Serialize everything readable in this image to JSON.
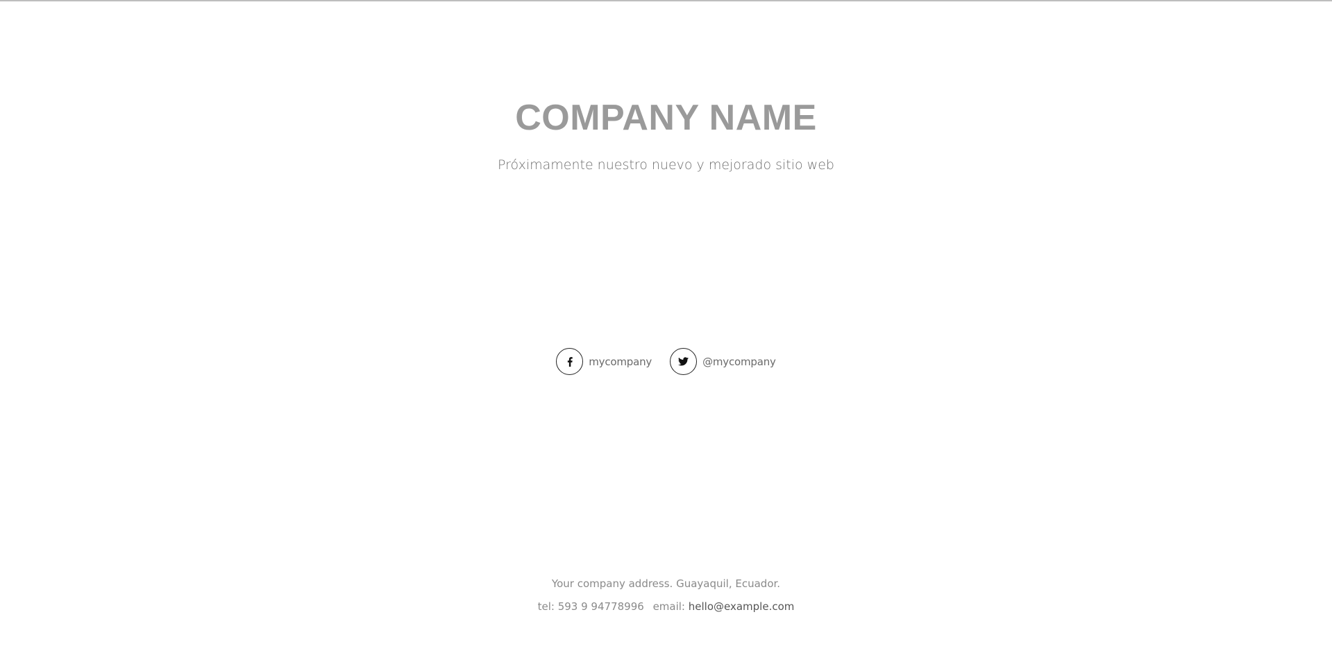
{
  "hero": {
    "title": "COMPANY NAME",
    "tagline": "Próximamente nuestro nuevo y mejorado sitio web"
  },
  "social": {
    "facebook": {
      "icon": "facebook-icon",
      "label": "mycompany"
    },
    "twitter": {
      "icon": "twitter-icon",
      "label": "@mycompany"
    }
  },
  "footer": {
    "address": "Your company address. Guayaquil, Ecuador.",
    "tel_label": "tel:",
    "tel_value": "593 9 94778996",
    "email_label": "email:",
    "email_value": "hello@example.com"
  },
  "colors": {
    "title": "#9a9a9a",
    "text": "#6f6f6f",
    "icon_border": "#222222"
  }
}
